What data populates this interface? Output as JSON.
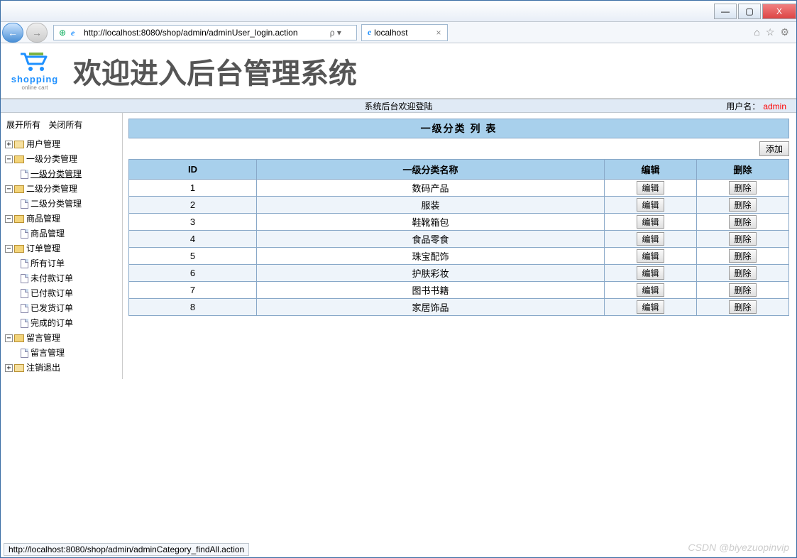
{
  "window": {
    "min": "—",
    "max": "▢",
    "close": "X"
  },
  "nav": {
    "back": "←",
    "fwd": "→"
  },
  "url": "http://localhost:8080/shop/admin/adminUser_login.action",
  "searchHint": "ρ ▾",
  "tab": {
    "title": "localhost",
    "close": "×"
  },
  "toolIcons": {
    "home": "⌂",
    "star": "☆",
    "gear": "⚙"
  },
  "logo": {
    "line1": "shopping",
    "line2": "online cart"
  },
  "header": "欢迎进入后台管理系统",
  "statusCenter": "系统后台欢迎登陆",
  "statusRightLabel": "用户名：",
  "username": "admin",
  "sidebar": {
    "expandAll": "展开所有",
    "collapseAll": "关闭所有",
    "nodes": [
      {
        "type": "root-closed",
        "label": "用户管理"
      },
      {
        "type": "root-open",
        "label": "一级分类管理",
        "children": [
          {
            "label": "一级分类管理",
            "active": true
          }
        ]
      },
      {
        "type": "root-open",
        "label": "二级分类管理",
        "children": [
          {
            "label": "二级分类管理"
          }
        ]
      },
      {
        "type": "root-open",
        "label": "商品管理",
        "children": [
          {
            "label": "商品管理"
          }
        ]
      },
      {
        "type": "root-open",
        "label": "订单管理",
        "children": [
          {
            "label": "所有订单"
          },
          {
            "label": "未付款订单"
          },
          {
            "label": "已付款订单"
          },
          {
            "label": "已发货订单"
          },
          {
            "label": "完成的订单"
          }
        ]
      },
      {
        "type": "root-open",
        "label": "留言管理",
        "children": [
          {
            "label": "留言管理"
          }
        ]
      },
      {
        "type": "root-closed",
        "label": "注销退出"
      }
    ]
  },
  "panel": {
    "title": "一级分类 列 表",
    "addLabel": "添加",
    "columns": {
      "id": "ID",
      "name": "一级分类名称",
      "edit": "编辑",
      "del": "删除"
    },
    "editBtn": "编辑",
    "delBtn": "删除",
    "rows": [
      {
        "id": "1",
        "name": "数码产品"
      },
      {
        "id": "2",
        "name": "服装"
      },
      {
        "id": "3",
        "name": "鞋靴箱包"
      },
      {
        "id": "4",
        "name": "食品零食"
      },
      {
        "id": "5",
        "name": "珠宝配饰"
      },
      {
        "id": "6",
        "name": "护肤彩妆"
      },
      {
        "id": "7",
        "name": "图书书籍"
      },
      {
        "id": "8",
        "name": "家居饰品"
      }
    ]
  },
  "statusLink": "http://localhost:8080/shop/admin/adminCategory_findAll.action",
  "watermark": "CSDN @biyezuopinvip"
}
